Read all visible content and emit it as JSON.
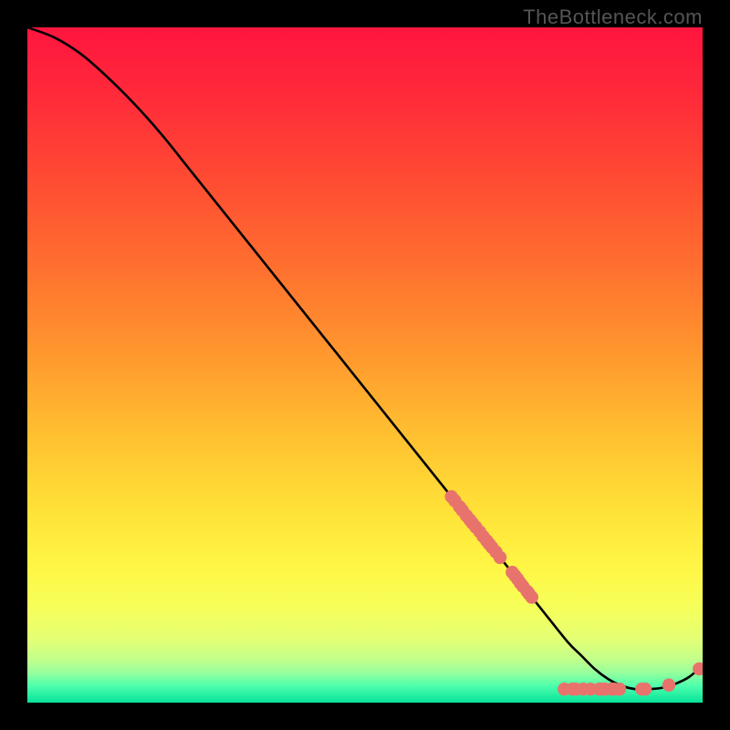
{
  "watermark": "TheBottleneck.com",
  "chart_data": {
    "type": "line",
    "title": "",
    "xlabel": "",
    "ylabel": "",
    "xlim": [
      0,
      100
    ],
    "ylim": [
      0,
      100
    ],
    "grid": false,
    "series": [
      {
        "name": "curve",
        "x": [
          0,
          4,
          8,
          12,
          16,
          20,
          24,
          28,
          32,
          36,
          40,
          44,
          48,
          52,
          56,
          60,
          64,
          68,
          72,
          76,
          80,
          82,
          84,
          86,
          88,
          90,
          92,
          94,
          96,
          98,
          100
        ],
        "y": [
          100,
          98.5,
          96,
          92.5,
          88.5,
          84,
          79,
          74,
          69,
          64,
          59,
          54,
          49,
          44,
          39,
          34,
          29,
          24,
          19,
          14,
          9,
          7,
          5,
          3.5,
          2.5,
          2,
          2,
          2.2,
          2.8,
          3.8,
          5.5
        ]
      }
    ],
    "markers": [
      {
        "x": 62.8,
        "y": 30.5
      },
      {
        "x": 63.3,
        "y": 29.9
      },
      {
        "x": 64.0,
        "y": 29.0
      },
      {
        "x": 64.4,
        "y": 28.5
      },
      {
        "x": 65.0,
        "y": 27.7
      },
      {
        "x": 65.5,
        "y": 27.1
      },
      {
        "x": 65.9,
        "y": 26.6
      },
      {
        "x": 66.4,
        "y": 26.0
      },
      {
        "x": 67.0,
        "y": 25.3
      },
      {
        "x": 67.5,
        "y": 24.6
      },
      {
        "x": 68.0,
        "y": 24.0
      },
      {
        "x": 68.4,
        "y": 23.5
      },
      {
        "x": 68.8,
        "y": 23.0
      },
      {
        "x": 69.4,
        "y": 22.3
      },
      {
        "x": 70.0,
        "y": 21.5
      },
      {
        "x": 71.8,
        "y": 19.3
      },
      {
        "x": 72.2,
        "y": 18.8
      },
      {
        "x": 72.6,
        "y": 18.3
      },
      {
        "x": 73.0,
        "y": 17.7
      },
      {
        "x": 73.4,
        "y": 17.2
      },
      {
        "x": 74.0,
        "y": 16.5
      },
      {
        "x": 74.3,
        "y": 16.1
      },
      {
        "x": 74.7,
        "y": 15.6
      },
      {
        "x": 79.5,
        "y": 2.0
      },
      {
        "x": 80.7,
        "y": 2.0
      },
      {
        "x": 81.2,
        "y": 2.0
      },
      {
        "x": 82.3,
        "y": 2.0
      },
      {
        "x": 83.4,
        "y": 2.0
      },
      {
        "x": 84.7,
        "y": 2.0
      },
      {
        "x": 85.1,
        "y": 2.0
      },
      {
        "x": 85.5,
        "y": 2.0
      },
      {
        "x": 86.5,
        "y": 2.0
      },
      {
        "x": 86.9,
        "y": 2.0
      },
      {
        "x": 87.7,
        "y": 2.0
      },
      {
        "x": 91.0,
        "y": 2.0
      },
      {
        "x": 91.5,
        "y": 2.0
      },
      {
        "x": 95.0,
        "y": 2.6
      },
      {
        "x": 99.5,
        "y": 5.0
      }
    ],
    "gradient_stops": [
      {
        "offset": 0.0,
        "color": "#ff153f"
      },
      {
        "offset": 0.1,
        "color": "#ff2a3a"
      },
      {
        "offset": 0.22,
        "color": "#ff4a33"
      },
      {
        "offset": 0.35,
        "color": "#ff6e2f"
      },
      {
        "offset": 0.48,
        "color": "#ff962e"
      },
      {
        "offset": 0.6,
        "color": "#ffbf30"
      },
      {
        "offset": 0.72,
        "color": "#ffe338"
      },
      {
        "offset": 0.8,
        "color": "#fff645"
      },
      {
        "offset": 0.86,
        "color": "#f6ff5a"
      },
      {
        "offset": 0.905,
        "color": "#e4ff74"
      },
      {
        "offset": 0.935,
        "color": "#c4ff8a"
      },
      {
        "offset": 0.955,
        "color": "#98ff9c"
      },
      {
        "offset": 0.975,
        "color": "#4effac"
      },
      {
        "offset": 1.0,
        "color": "#06e39a"
      }
    ],
    "marker_color": "#e8726c",
    "curve_color": "#000000"
  }
}
